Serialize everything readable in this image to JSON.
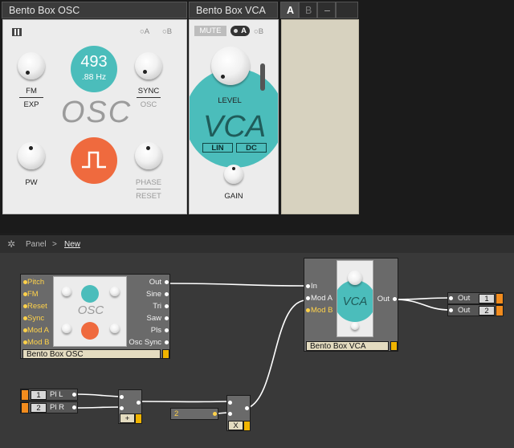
{
  "rack": {
    "osc_title": "Bento Box OSC",
    "vca_title": "Bento Box VCA",
    "tab_a": "A",
    "tab_b": "B",
    "tab_minus": "–",
    "osc": {
      "sel_a": "A",
      "sel_b": "B",
      "freq_big": "493",
      "freq_small": ".88 Hz",
      "fm": "FM",
      "exp": "EXP",
      "sync": "SYNC",
      "osc_small": "OSC",
      "logo": "OSC",
      "pw": "PW",
      "phase": "PHASE",
      "reset": "RESET"
    },
    "vca": {
      "mute": "MUTE",
      "sel_a": "A",
      "sel_b": "B",
      "level": "LEVEL",
      "logo": "VCA",
      "lin": "LIN",
      "dc": "DC",
      "gain": "GAIN"
    }
  },
  "breadcrumb": {
    "panel": "Panel",
    "sep": ">",
    "current": "New"
  },
  "patch": {
    "osc_module": {
      "name": "Bento Box OSC",
      "inputs": [
        "Pitch",
        "FM",
        "Reset",
        "Sync",
        "Mod A",
        "Mod B"
      ],
      "outputs": [
        "Out",
        "Sine",
        "Tri",
        "Saw",
        "Pls",
        "Osc Sync"
      ]
    },
    "vca_module": {
      "name": "Bento Box VCA",
      "inputs": [
        "In",
        "Mod A",
        "Mod B"
      ],
      "output": "Out"
    },
    "outputs": [
      {
        "label": "Out",
        "num": "1"
      },
      {
        "label": "Out",
        "num": "2"
      }
    ],
    "inputs": [
      {
        "num": "1",
        "label": "Pl L"
      },
      {
        "num": "2",
        "label": "Pl R"
      }
    ],
    "add_label": "+",
    "mult_label": "X",
    "const_value": "2"
  },
  "colors": {
    "teal": "#4bbdbb",
    "orange": "#ef6a3e",
    "port_yellow": "#ffd24a"
  }
}
